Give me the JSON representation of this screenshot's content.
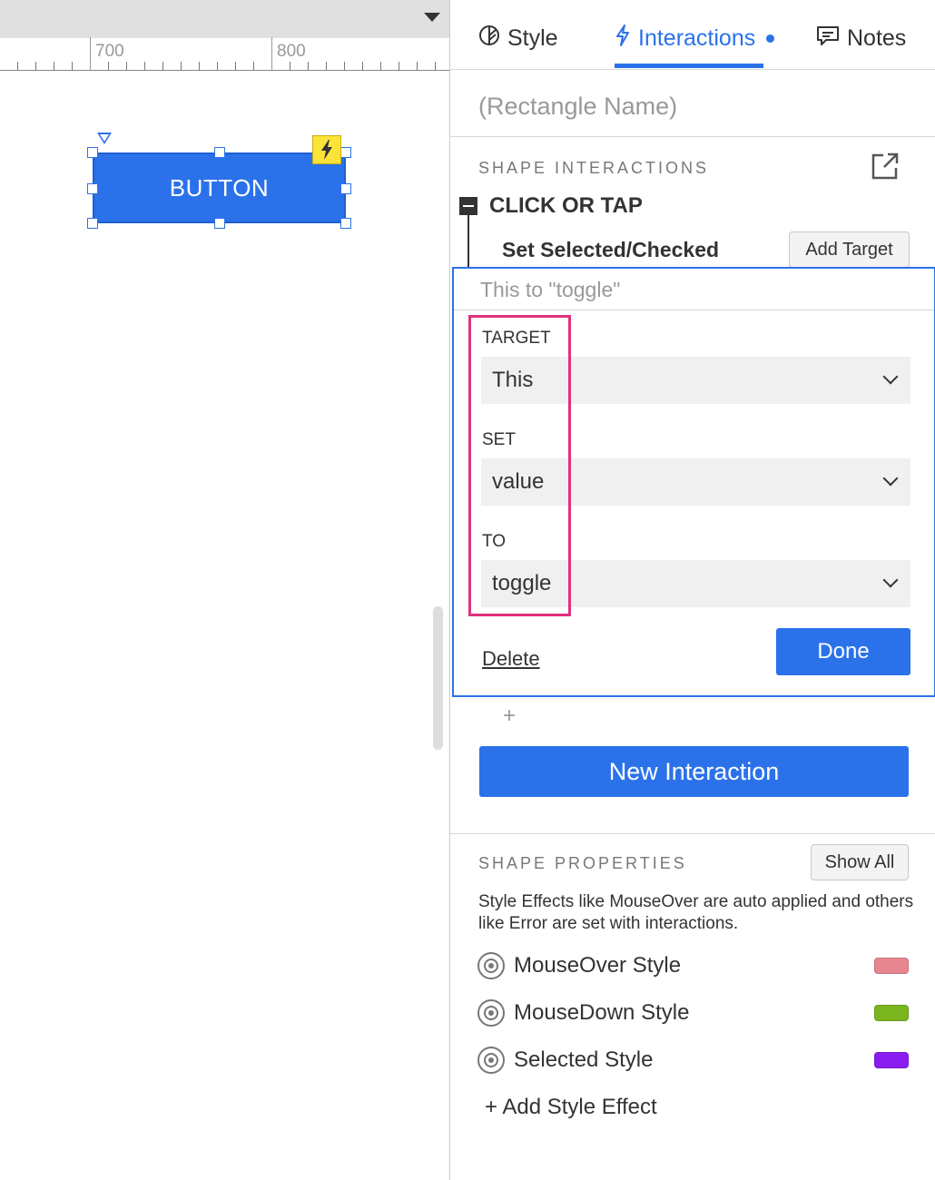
{
  "canvas": {
    "ruler": {
      "labels": [
        "700",
        "800"
      ]
    },
    "widget": {
      "label": "BUTTON",
      "fill_color": "#2b72ea"
    }
  },
  "panel": {
    "tabs": [
      {
        "label": "Style",
        "icon": "leaf-icon"
      },
      {
        "label": "Interactions",
        "icon": "lightning-icon",
        "active": true
      },
      {
        "label": "Notes",
        "icon": "comment-icon"
      }
    ],
    "name_placeholder": "(Rectangle Name)",
    "shape_interactions": {
      "title": "SHAPE INTERACTIONS",
      "event": "CLICK OR TAP",
      "action": "Set Selected/Checked",
      "add_target_label": "Add Target",
      "summary": "This to \"toggle\"",
      "fields": {
        "target": {
          "label": "TARGET",
          "value": "This"
        },
        "set": {
          "label": "SET",
          "value": "value"
        },
        "to": {
          "label": "TO",
          "value": "toggle"
        }
      },
      "delete_label": "Delete",
      "done_label": "Done",
      "add_action_symbol": "+",
      "new_interaction_label": "New Interaction"
    },
    "shape_properties": {
      "title": "SHAPE PROPERTIES",
      "show_all_label": "Show All",
      "description": "Style Effects like MouseOver are auto applied and others like Error are set with interactions.",
      "styles": [
        {
          "label": "MouseOver Style",
          "color": "#e88690"
        },
        {
          "label": "MouseDown Style",
          "color": "#7ab51f"
        },
        {
          "label": "Selected Style",
          "color": "#8a1cf2"
        }
      ],
      "add_style_effect_label": "+ Add Style Effect"
    },
    "accent_color": "#2b72ea",
    "highlight_color": "#e0317c"
  }
}
